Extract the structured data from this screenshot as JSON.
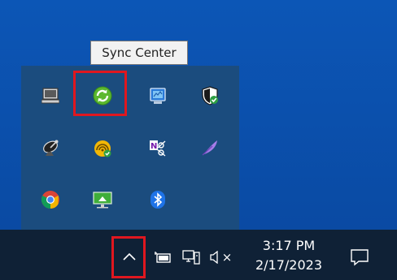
{
  "tooltip": {
    "text": "Sync Center"
  },
  "tray_flyout": {
    "icons": [
      {
        "name": "laptop-icon"
      },
      {
        "name": "sync-center-icon"
      },
      {
        "name": "network-monitor-icon"
      },
      {
        "name": "windows-security-icon"
      },
      {
        "name": "satellite-dish-icon"
      },
      {
        "name": "wireless-signal-icon"
      },
      {
        "name": "onenote-clipper-icon"
      },
      {
        "name": "feather-icon"
      },
      {
        "name": "chrome-icon"
      },
      {
        "name": "remote-display-icon"
      },
      {
        "name": "bluetooth-icon"
      }
    ]
  },
  "taskbar": {
    "clock": {
      "time": "3:17 PM",
      "date": "2/17/2023"
    },
    "volume_status": "×"
  },
  "colors": {
    "desktop": "#0a4fa8",
    "flyout": "#1b4c7e",
    "taskbar": "#0f2136",
    "highlight": "#e0171f"
  }
}
